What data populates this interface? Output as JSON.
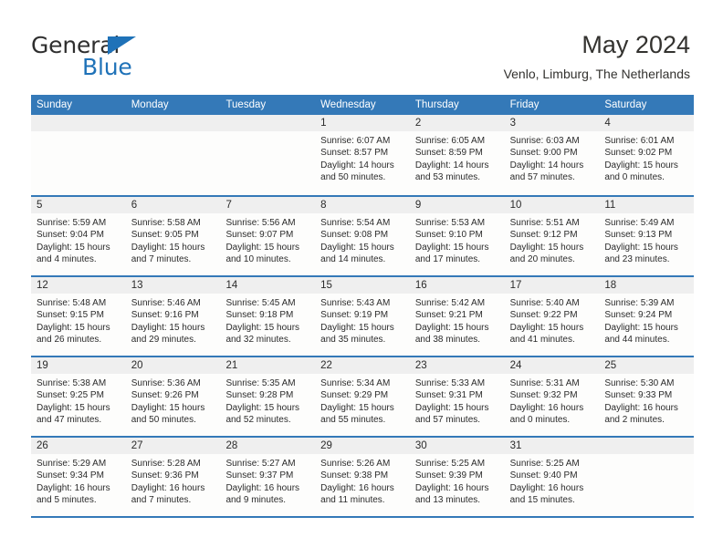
{
  "brand": {
    "name_top": "General",
    "name_bottom": "Blue",
    "accent_color": "#1f72b8"
  },
  "header": {
    "title": "May 2024",
    "subtitle": "Venlo, Limburg, The Netherlands"
  },
  "theme": {
    "header_bar": "#3479b8",
    "day_number_band": "#efefef",
    "cell_bg": "#fdfdfc",
    "text": "#2b2b2b"
  },
  "weekdays": [
    "Sunday",
    "Monday",
    "Tuesday",
    "Wednesday",
    "Thursday",
    "Friday",
    "Saturday"
  ],
  "weeks": [
    [
      {
        "day": ""
      },
      {
        "day": ""
      },
      {
        "day": ""
      },
      {
        "day": "1",
        "sunrise": "Sunrise: 6:07 AM",
        "sunset": "Sunset: 8:57 PM",
        "daylight": "Daylight: 14 hours and 50 minutes."
      },
      {
        "day": "2",
        "sunrise": "Sunrise: 6:05 AM",
        "sunset": "Sunset: 8:59 PM",
        "daylight": "Daylight: 14 hours and 53 minutes."
      },
      {
        "day": "3",
        "sunrise": "Sunrise: 6:03 AM",
        "sunset": "Sunset: 9:00 PM",
        "daylight": "Daylight: 14 hours and 57 minutes."
      },
      {
        "day": "4",
        "sunrise": "Sunrise: 6:01 AM",
        "sunset": "Sunset: 9:02 PM",
        "daylight": "Daylight: 15 hours and 0 minutes."
      }
    ],
    [
      {
        "day": "5",
        "sunrise": "Sunrise: 5:59 AM",
        "sunset": "Sunset: 9:04 PM",
        "daylight": "Daylight: 15 hours and 4 minutes."
      },
      {
        "day": "6",
        "sunrise": "Sunrise: 5:58 AM",
        "sunset": "Sunset: 9:05 PM",
        "daylight": "Daylight: 15 hours and 7 minutes."
      },
      {
        "day": "7",
        "sunrise": "Sunrise: 5:56 AM",
        "sunset": "Sunset: 9:07 PM",
        "daylight": "Daylight: 15 hours and 10 minutes."
      },
      {
        "day": "8",
        "sunrise": "Sunrise: 5:54 AM",
        "sunset": "Sunset: 9:08 PM",
        "daylight": "Daylight: 15 hours and 14 minutes."
      },
      {
        "day": "9",
        "sunrise": "Sunrise: 5:53 AM",
        "sunset": "Sunset: 9:10 PM",
        "daylight": "Daylight: 15 hours and 17 minutes."
      },
      {
        "day": "10",
        "sunrise": "Sunrise: 5:51 AM",
        "sunset": "Sunset: 9:12 PM",
        "daylight": "Daylight: 15 hours and 20 minutes."
      },
      {
        "day": "11",
        "sunrise": "Sunrise: 5:49 AM",
        "sunset": "Sunset: 9:13 PM",
        "daylight": "Daylight: 15 hours and 23 minutes."
      }
    ],
    [
      {
        "day": "12",
        "sunrise": "Sunrise: 5:48 AM",
        "sunset": "Sunset: 9:15 PM",
        "daylight": "Daylight: 15 hours and 26 minutes."
      },
      {
        "day": "13",
        "sunrise": "Sunrise: 5:46 AM",
        "sunset": "Sunset: 9:16 PM",
        "daylight": "Daylight: 15 hours and 29 minutes."
      },
      {
        "day": "14",
        "sunrise": "Sunrise: 5:45 AM",
        "sunset": "Sunset: 9:18 PM",
        "daylight": "Daylight: 15 hours and 32 minutes."
      },
      {
        "day": "15",
        "sunrise": "Sunrise: 5:43 AM",
        "sunset": "Sunset: 9:19 PM",
        "daylight": "Daylight: 15 hours and 35 minutes."
      },
      {
        "day": "16",
        "sunrise": "Sunrise: 5:42 AM",
        "sunset": "Sunset: 9:21 PM",
        "daylight": "Daylight: 15 hours and 38 minutes."
      },
      {
        "day": "17",
        "sunrise": "Sunrise: 5:40 AM",
        "sunset": "Sunset: 9:22 PM",
        "daylight": "Daylight: 15 hours and 41 minutes."
      },
      {
        "day": "18",
        "sunrise": "Sunrise: 5:39 AM",
        "sunset": "Sunset: 9:24 PM",
        "daylight": "Daylight: 15 hours and 44 minutes."
      }
    ],
    [
      {
        "day": "19",
        "sunrise": "Sunrise: 5:38 AM",
        "sunset": "Sunset: 9:25 PM",
        "daylight": "Daylight: 15 hours and 47 minutes."
      },
      {
        "day": "20",
        "sunrise": "Sunrise: 5:36 AM",
        "sunset": "Sunset: 9:26 PM",
        "daylight": "Daylight: 15 hours and 50 minutes."
      },
      {
        "day": "21",
        "sunrise": "Sunrise: 5:35 AM",
        "sunset": "Sunset: 9:28 PM",
        "daylight": "Daylight: 15 hours and 52 minutes."
      },
      {
        "day": "22",
        "sunrise": "Sunrise: 5:34 AM",
        "sunset": "Sunset: 9:29 PM",
        "daylight": "Daylight: 15 hours and 55 minutes."
      },
      {
        "day": "23",
        "sunrise": "Sunrise: 5:33 AM",
        "sunset": "Sunset: 9:31 PM",
        "daylight": "Daylight: 15 hours and 57 minutes."
      },
      {
        "day": "24",
        "sunrise": "Sunrise: 5:31 AM",
        "sunset": "Sunset: 9:32 PM",
        "daylight": "Daylight: 16 hours and 0 minutes."
      },
      {
        "day": "25",
        "sunrise": "Sunrise: 5:30 AM",
        "sunset": "Sunset: 9:33 PM",
        "daylight": "Daylight: 16 hours and 2 minutes."
      }
    ],
    [
      {
        "day": "26",
        "sunrise": "Sunrise: 5:29 AM",
        "sunset": "Sunset: 9:34 PM",
        "daylight": "Daylight: 16 hours and 5 minutes."
      },
      {
        "day": "27",
        "sunrise": "Sunrise: 5:28 AM",
        "sunset": "Sunset: 9:36 PM",
        "daylight": "Daylight: 16 hours and 7 minutes."
      },
      {
        "day": "28",
        "sunrise": "Sunrise: 5:27 AM",
        "sunset": "Sunset: 9:37 PM",
        "daylight": "Daylight: 16 hours and 9 minutes."
      },
      {
        "day": "29",
        "sunrise": "Sunrise: 5:26 AM",
        "sunset": "Sunset: 9:38 PM",
        "daylight": "Daylight: 16 hours and 11 minutes."
      },
      {
        "day": "30",
        "sunrise": "Sunrise: 5:25 AM",
        "sunset": "Sunset: 9:39 PM",
        "daylight": "Daylight: 16 hours and 13 minutes."
      },
      {
        "day": "31",
        "sunrise": "Sunrise: 5:25 AM",
        "sunset": "Sunset: 9:40 PM",
        "daylight": "Daylight: 16 hours and 15 minutes."
      },
      {
        "day": ""
      }
    ]
  ]
}
